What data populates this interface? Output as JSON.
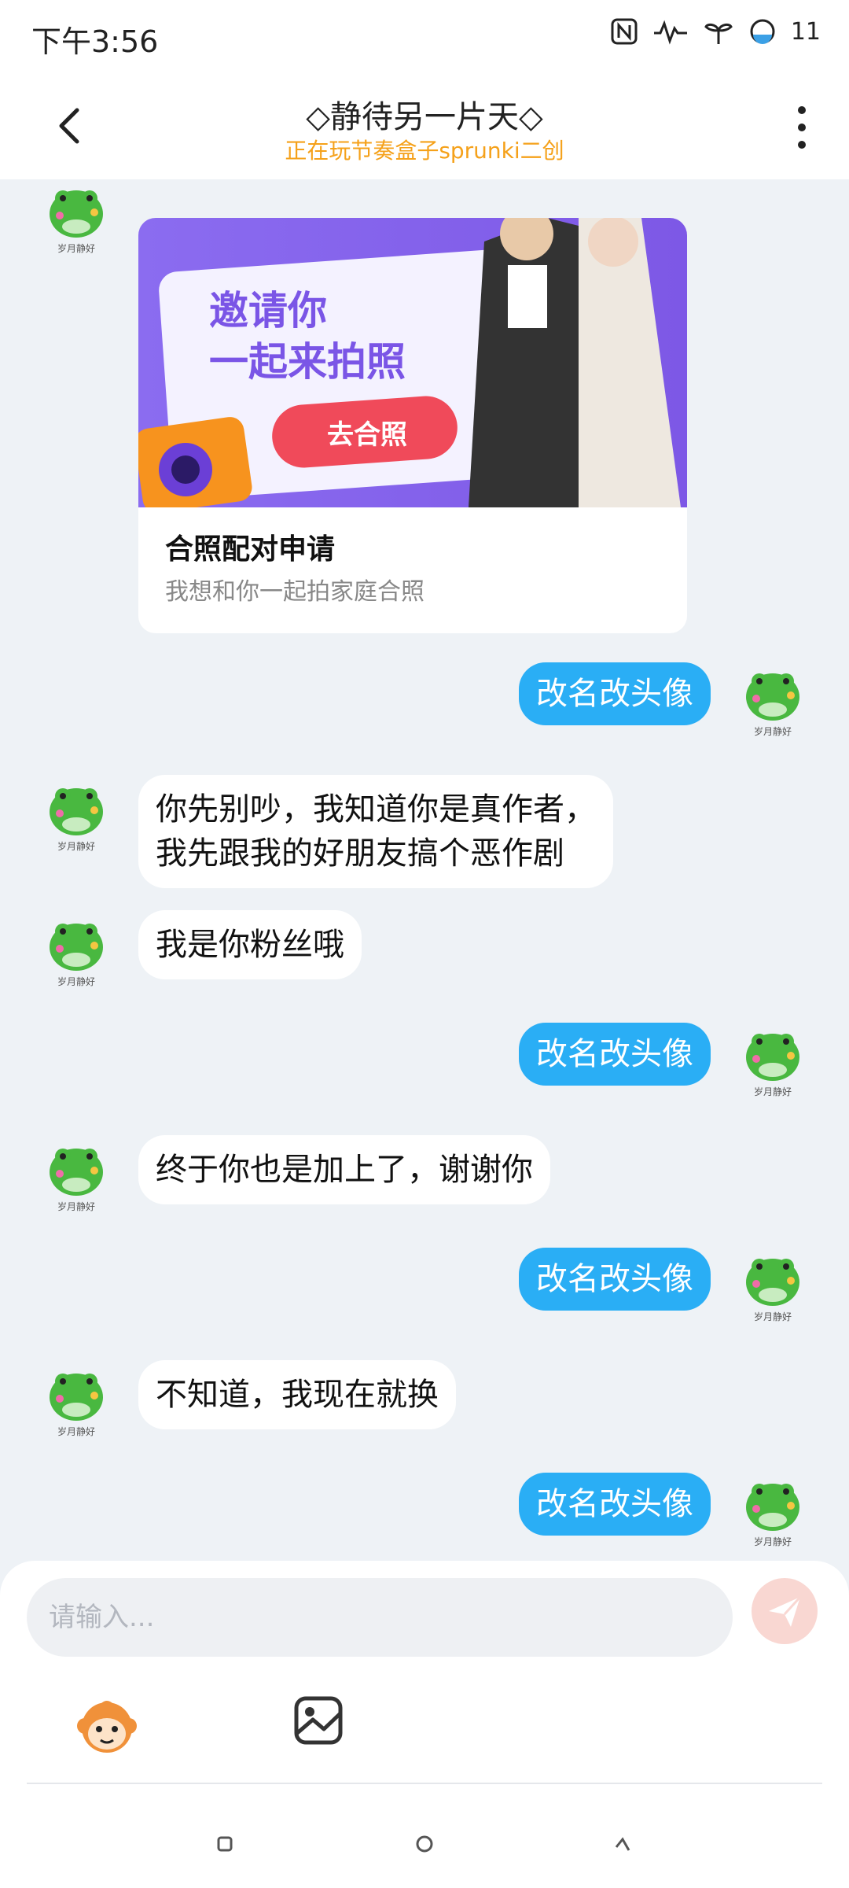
{
  "status": {
    "time": "下午3:56",
    "battery": "11"
  },
  "header": {
    "title": "◇静待另一片天◇",
    "subtitle": "正在玩节奏盒子sprunki二创"
  },
  "avatar_caption": "岁月静好",
  "card": {
    "banner_line1": "邀请你",
    "banner_line2": "一起来拍照",
    "banner_button": "去合照",
    "title": "合照配对申请",
    "subtitle": "我想和你一起拍家庭合照"
  },
  "messages": [
    {
      "side": "right",
      "text": "改名改头像"
    },
    {
      "side": "left",
      "text": "你先别吵，我知道你是真作者，\n我先跟我的好朋友搞个恶作剧"
    },
    {
      "side": "left",
      "text": "我是你粉丝哦"
    },
    {
      "side": "right",
      "text": "改名改头像"
    },
    {
      "side": "left",
      "text": "终于你也是加上了，谢谢你"
    },
    {
      "side": "right",
      "text": "改名改头像"
    },
    {
      "side": "left",
      "text": "不知道，我现在就换"
    },
    {
      "side": "right",
      "text": "改名改头像"
    }
  ],
  "input": {
    "placeholder": "请输入..."
  },
  "colors": {
    "accent_blue": "#2aaef5",
    "subtitle_orange": "#f5a11a",
    "banner_purple": "#7d58e6",
    "button_red": "#f04a5a"
  },
  "icons": {
    "send": "send-icon",
    "emoji": "monkey-sticker-icon",
    "image": "image-icon"
  }
}
